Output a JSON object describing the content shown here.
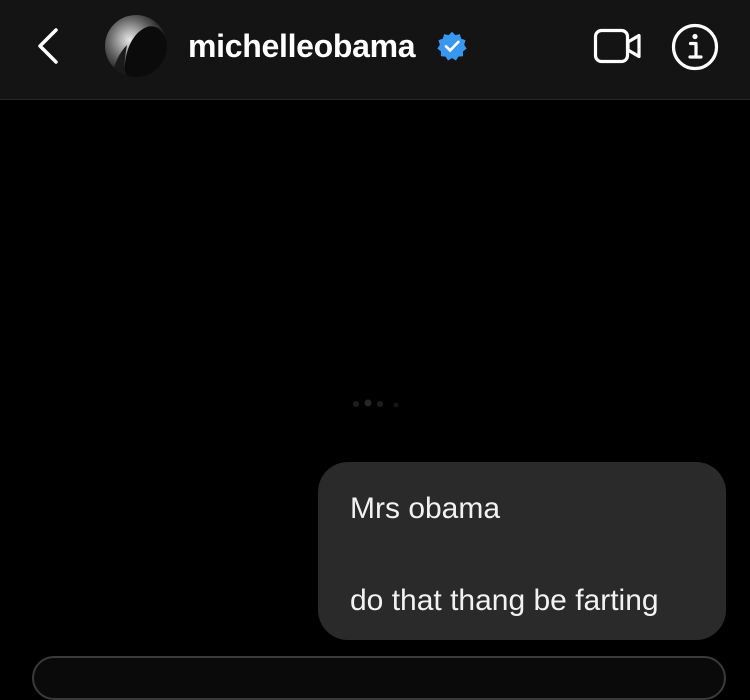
{
  "header": {
    "username": "michelleobama",
    "verified": true,
    "icons": {
      "back": "chevron-left-icon",
      "verified": "verified-badge-icon",
      "video": "video-camera-icon",
      "info": "info-icon"
    }
  },
  "messages": [
    {
      "sender": "me",
      "lines": [
        "Mrs obama",
        "do that thang be farting"
      ]
    }
  ],
  "colors": {
    "background": "#000000",
    "header_background": "#141414",
    "outgoing_bubble": "#2a2a2a",
    "verified_blue": "#3897f0",
    "text": "#ffffff"
  }
}
